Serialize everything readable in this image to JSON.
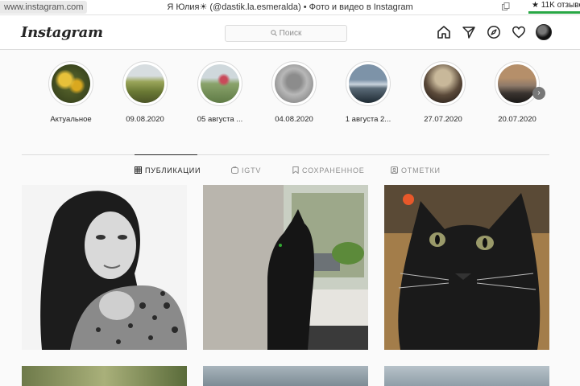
{
  "browser": {
    "url": "www.instagram.com",
    "title": "Я Юлия☀ (@dastik.la.esmeralda) • Фото и видео в Instagram",
    "reviews": "★ 11K отзыво"
  },
  "header": {
    "logo": "Instagram",
    "search_placeholder": "Поиск",
    "nav_icons": [
      "home-icon",
      "direct-icon",
      "explore-icon",
      "heart-icon",
      "avatar"
    ]
  },
  "stories": [
    {
      "label": "Актуальное"
    },
    {
      "label": "09.08.2020"
    },
    {
      "label": "05 августа ..."
    },
    {
      "label": "04.08.2020"
    },
    {
      "label": "1 августа 2..."
    },
    {
      "label": "27.07.2020"
    },
    {
      "label": "20.07.2020"
    }
  ],
  "tabs": [
    {
      "label": "ПУБЛИКАЦИИ",
      "icon": "grid-icon",
      "active": true
    },
    {
      "label": "IGTV",
      "icon": "igtv-icon",
      "active": false
    },
    {
      "label": "СОХРАНЕННОЕ",
      "icon": "bookmark-icon",
      "active": false
    },
    {
      "label": "ОТМЕТКИ",
      "icon": "tagged-icon",
      "active": false
    }
  ],
  "colors": {
    "accent_green": "#28a745",
    "border": "#dbdbdb",
    "text": "#262626",
    "muted": "#8e8e8e"
  }
}
